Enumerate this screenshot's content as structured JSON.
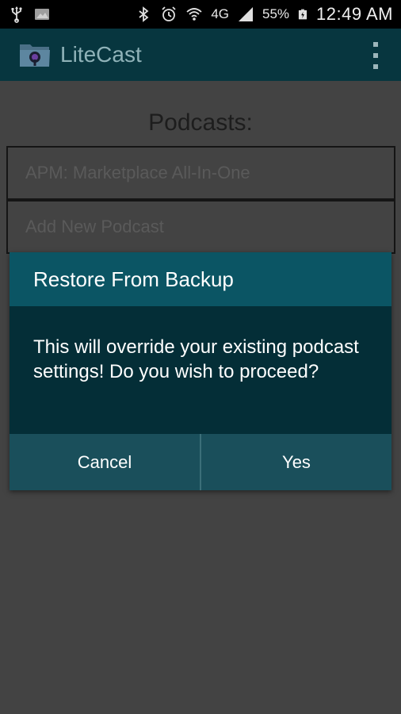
{
  "status_bar": {
    "icons": [
      "usb-icon",
      "image-icon",
      "bluetooth-icon",
      "alarm-icon",
      "wifi-icon",
      "lte-icon",
      "signal-icon",
      "battery-icon"
    ],
    "network_label": "4G",
    "battery_percent": "55%",
    "time": "12:49 AM"
  },
  "action_bar": {
    "app_name": "LiteCast",
    "color": "#07363f"
  },
  "main": {
    "heading": "Podcasts:",
    "podcasts": [
      "APM: Marketplace All-In-One"
    ],
    "add_label": "Add New Podcast"
  },
  "dialog": {
    "title": "Restore From Backup",
    "message": "This will override your existing podcast settings! Do you wish to proceed?",
    "cancel_label": "Cancel",
    "confirm_label": "Yes"
  }
}
